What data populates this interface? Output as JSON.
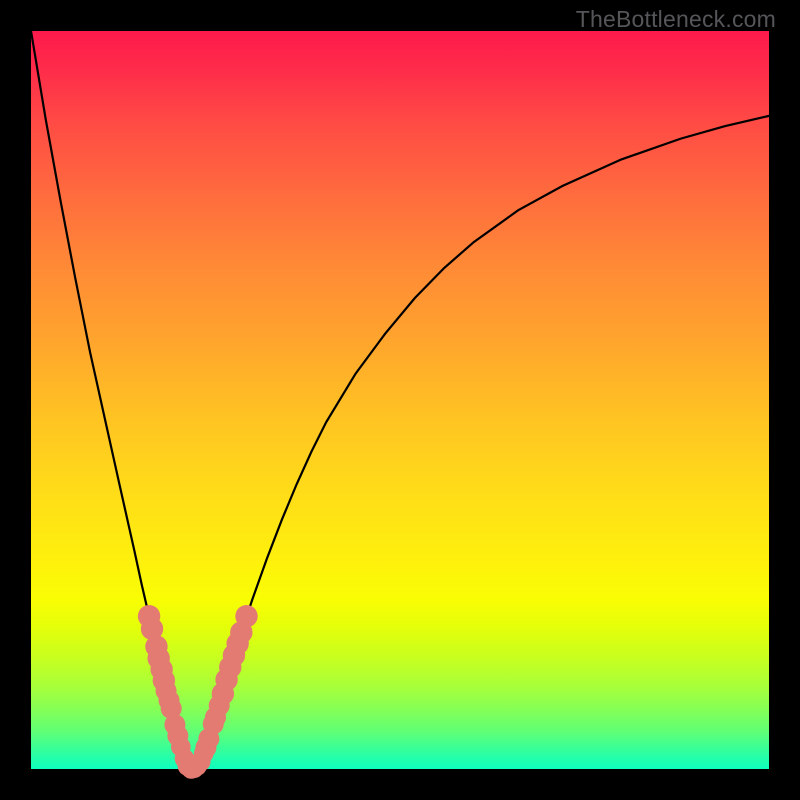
{
  "watermark": "TheBottleneck.com",
  "chart_data": {
    "type": "line",
    "title": "",
    "xlabel": "",
    "ylabel": "",
    "xlim": [
      0,
      100
    ],
    "ylim": [
      0,
      100
    ],
    "grid": false,
    "legend": false,
    "series": [
      {
        "name": "bottleneck-curve",
        "x": [
          0.0,
          2.0,
          4.0,
          6.0,
          8.0,
          10.0,
          12.0,
          14.0,
          15.0,
          16.0,
          17.0,
          18.0,
          19.0,
          20.0,
          21.0,
          22.0,
          23.0,
          24.0,
          25.0,
          26.0,
          28.0,
          30.0,
          32.0,
          34.0,
          36.0,
          38.0,
          40.0,
          44.0,
          48.0,
          52.0,
          56.0,
          60.0,
          66.0,
          72.0,
          80.0,
          88.0,
          94.0,
          100.0
        ],
        "y": [
          100.0,
          88.0,
          77.0,
          66.5,
          56.5,
          47.5,
          38.5,
          29.6,
          25.0,
          20.7,
          16.6,
          12.4,
          8.2,
          4.1,
          0.4,
          0.0,
          1.0,
          3.7,
          7.0,
          10.4,
          17.0,
          23.0,
          28.6,
          33.8,
          38.6,
          43.0,
          47.0,
          53.6,
          59.0,
          63.8,
          67.9,
          71.4,
          75.7,
          79.0,
          82.6,
          85.4,
          87.1,
          88.5
        ]
      }
    ],
    "markers": {
      "name": "highlight-dots",
      "color": "#e37b72",
      "points": [
        {
          "x": 16.0,
          "y": 20.7,
          "r": 1.1
        },
        {
          "x": 16.4,
          "y": 19.0,
          "r": 1.1
        },
        {
          "x": 17.0,
          "y": 16.6,
          "r": 1.1
        },
        {
          "x": 17.3,
          "y": 15.0,
          "r": 1.1
        },
        {
          "x": 17.7,
          "y": 13.5,
          "r": 1.1
        },
        {
          "x": 18.0,
          "y": 12.0,
          "r": 1.1
        },
        {
          "x": 18.3,
          "y": 10.6,
          "r": 1.0
        },
        {
          "x": 18.7,
          "y": 9.3,
          "r": 1.0
        },
        {
          "x": 19.0,
          "y": 8.2,
          "r": 1.0
        },
        {
          "x": 19.5,
          "y": 6.0,
          "r": 1.0
        },
        {
          "x": 19.9,
          "y": 4.5,
          "r": 1.0
        },
        {
          "x": 20.3,
          "y": 3.0,
          "r": 0.9
        },
        {
          "x": 20.8,
          "y": 1.4,
          "r": 0.9
        },
        {
          "x": 21.2,
          "y": 0.4,
          "r": 0.9
        },
        {
          "x": 21.7,
          "y": 0.0,
          "r": 0.9
        },
        {
          "x": 22.1,
          "y": 0.1,
          "r": 0.9
        },
        {
          "x": 22.5,
          "y": 0.4,
          "r": 0.9
        },
        {
          "x": 23.0,
          "y": 1.0,
          "r": 0.9
        },
        {
          "x": 23.4,
          "y": 2.1,
          "r": 0.9
        },
        {
          "x": 23.7,
          "y": 2.9,
          "r": 1.0
        },
        {
          "x": 24.1,
          "y": 4.1,
          "r": 1.0
        },
        {
          "x": 24.7,
          "y": 6.1,
          "r": 1.0
        },
        {
          "x": 25.0,
          "y": 7.0,
          "r": 1.0
        },
        {
          "x": 25.5,
          "y": 8.6,
          "r": 1.0
        },
        {
          "x": 26.0,
          "y": 10.2,
          "r": 1.1
        },
        {
          "x": 26.5,
          "y": 12.1,
          "r": 1.1
        },
        {
          "x": 27.0,
          "y": 13.8,
          "r": 1.1
        },
        {
          "x": 27.5,
          "y": 15.4,
          "r": 1.1
        },
        {
          "x": 28.0,
          "y": 17.0,
          "r": 1.1
        },
        {
          "x": 28.5,
          "y": 18.5,
          "r": 1.1
        },
        {
          "x": 29.2,
          "y": 20.7,
          "r": 1.1
        }
      ]
    },
    "gradient_stops": [
      {
        "pos": 0.0,
        "color": "#fe1a4c"
      },
      {
        "pos": 0.25,
        "color": "#ff753c"
      },
      {
        "pos": 0.5,
        "color": "#ffbe24"
      },
      {
        "pos": 0.75,
        "color": "#f5fe06"
      },
      {
        "pos": 0.92,
        "color": "#7dff5c"
      },
      {
        "pos": 1.0,
        "color": "#0effbe"
      }
    ]
  }
}
